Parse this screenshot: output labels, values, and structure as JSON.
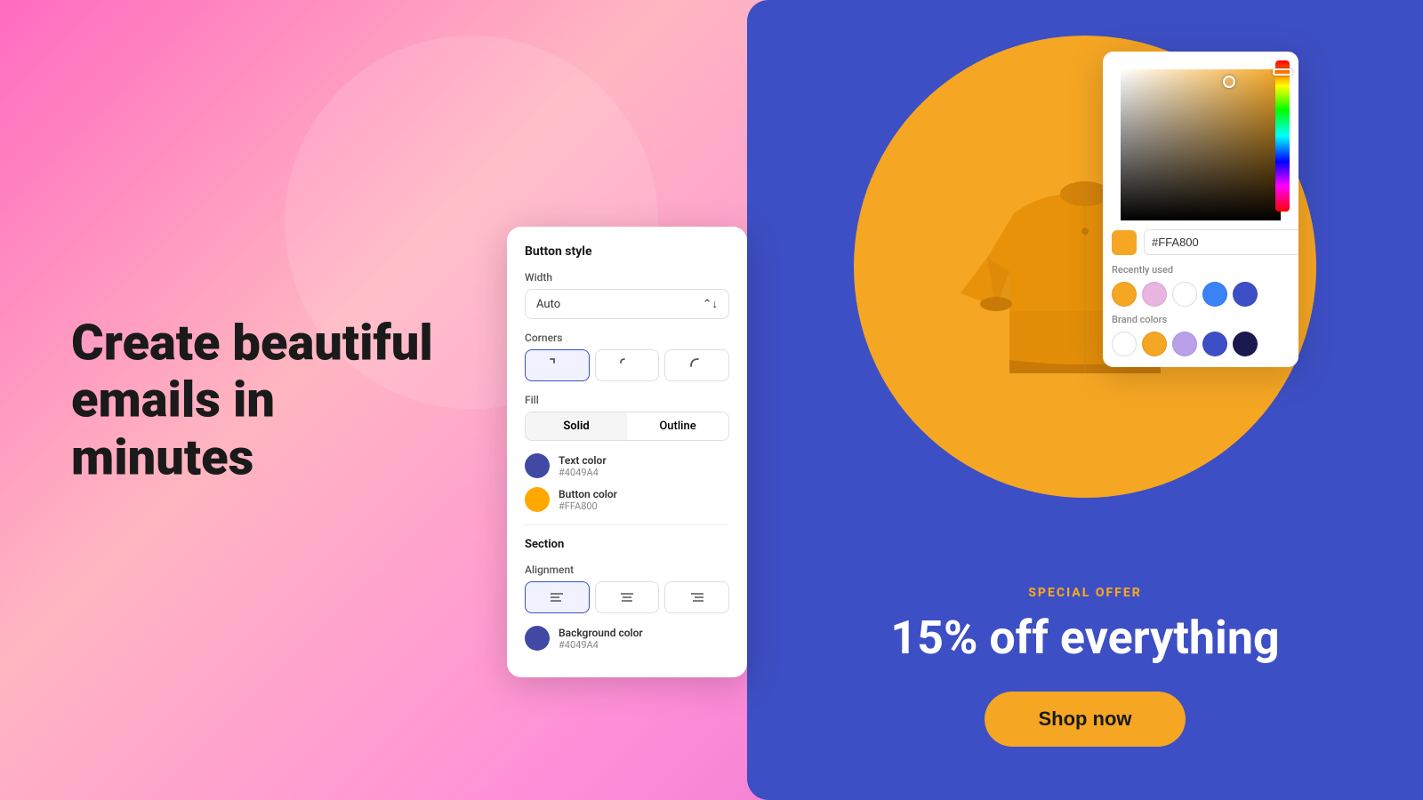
{
  "background": {
    "gradient": "linear-gradient(135deg, #FF6BC0 0%, #FFB6C1 30%, #FF8FD8 60%, #D966CC 100%)"
  },
  "hero": {
    "line1": "Create beautiful",
    "line2": "emails in minutes"
  },
  "button_style_panel": {
    "title": "Button style",
    "width_label": "Width",
    "width_value": "Auto",
    "corners_label": "Corners",
    "fill_label": "Fill",
    "fill_options": [
      "Solid",
      "Outline"
    ],
    "fill_active": "Solid",
    "text_color_label": "Text color",
    "text_color_hex": "#4049A4",
    "button_color_label": "Button color",
    "button_color_hex": "#FFA800",
    "section_label": "Section",
    "alignment_label": "Alignment",
    "bg_color_label": "Background color",
    "bg_color_hex": "#4049A4"
  },
  "color_picker": {
    "hex_value": "#FFA800",
    "recently_used_label": "Recently used",
    "brand_colors_label": "Brand colors",
    "recently_used_colors": [
      "#F5A623",
      "#E8B4E0",
      "#FFFFFF",
      "#3B82F6",
      "#3D4FC4"
    ],
    "brand_colors": [
      "#FFFFFF",
      "#F5A623",
      "#B9A0E8",
      "#3D4FC4",
      "#1a1a4e"
    ]
  },
  "email_preview": {
    "special_offer": "SPECIAL OFFER",
    "discount": "15% off everything",
    "shop_button": "Shop now"
  }
}
